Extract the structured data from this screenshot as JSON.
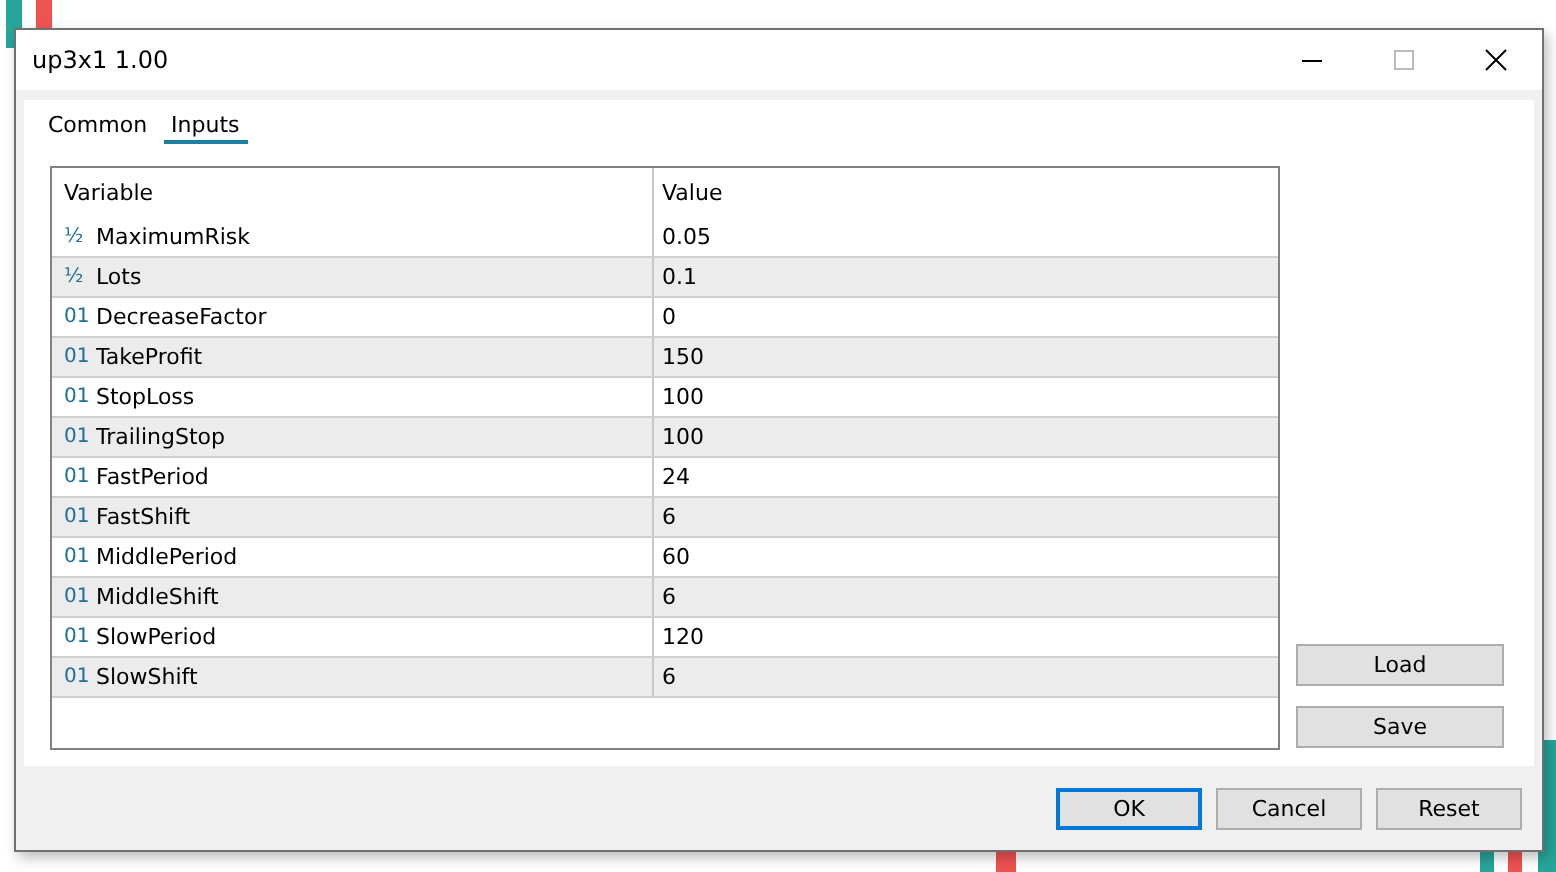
{
  "window": {
    "title": "up3x1 1.00"
  },
  "tabs": [
    {
      "label": "Common",
      "selected": false
    },
    {
      "label": "Inputs",
      "selected": true
    }
  ],
  "table": {
    "columns": [
      "Variable",
      "Value"
    ],
    "rows": [
      {
        "type_icon": "½",
        "variable": "MaximumRisk",
        "value": "0.05"
      },
      {
        "type_icon": "½",
        "variable": "Lots",
        "value": "0.1"
      },
      {
        "type_icon": "01",
        "variable": "DecreaseFactor",
        "value": "0"
      },
      {
        "type_icon": "01",
        "variable": "TakeProfit",
        "value": "150"
      },
      {
        "type_icon": "01",
        "variable": "StopLoss",
        "value": "100"
      },
      {
        "type_icon": "01",
        "variable": "TrailingStop",
        "value": "100"
      },
      {
        "type_icon": "01",
        "variable": "FastPeriod",
        "value": "24"
      },
      {
        "type_icon": "01",
        "variable": "FastShift",
        "value": "6"
      },
      {
        "type_icon": "01",
        "variable": "MiddlePeriod",
        "value": "60"
      },
      {
        "type_icon": "01",
        "variable": "MiddleShift",
        "value": "6"
      },
      {
        "type_icon": "01",
        "variable": "SlowPeriod",
        "value": "120"
      },
      {
        "type_icon": "01",
        "variable": "SlowShift",
        "value": "6"
      }
    ]
  },
  "side_buttons": [
    "Load",
    "Save"
  ],
  "footer_buttons": [
    {
      "label": "OK",
      "default": true
    },
    {
      "label": "Cancel",
      "default": false
    },
    {
      "label": "Reset",
      "default": false
    }
  ]
}
